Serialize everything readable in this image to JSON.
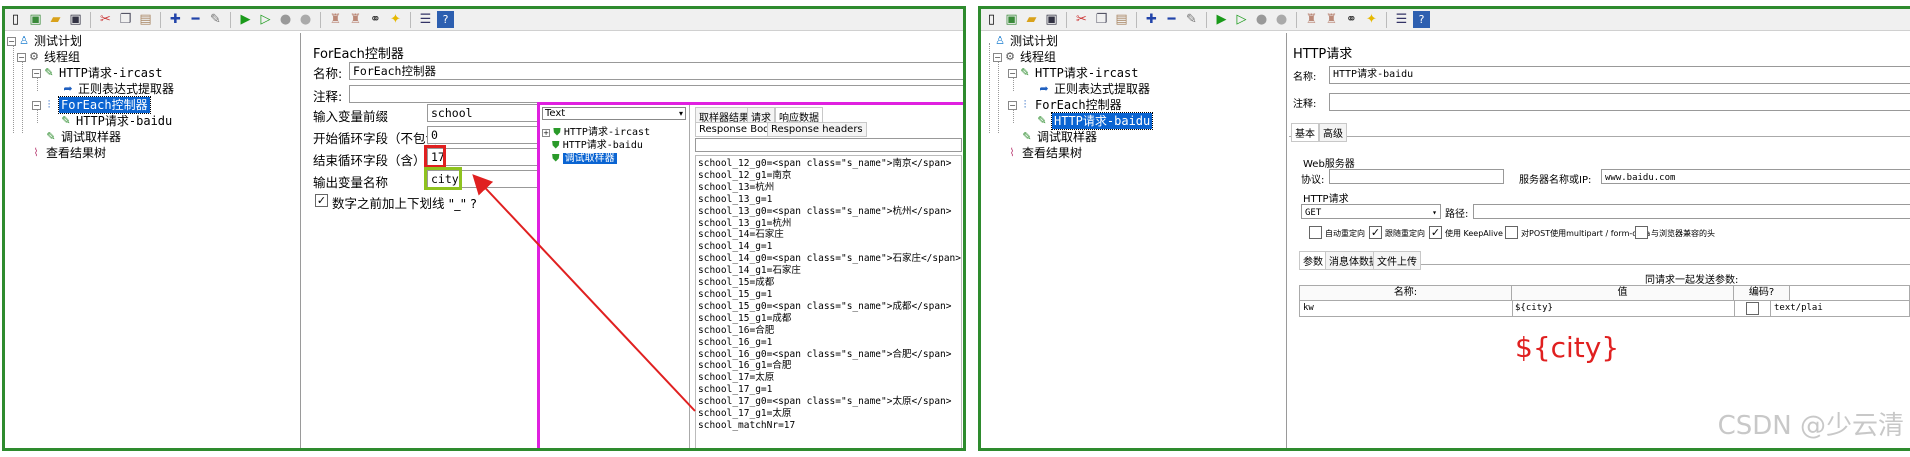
{
  "left": {
    "tree": {
      "root": "测试计划",
      "thread_group": "线程组",
      "http_ircast": "HTTP请求-ircast",
      "regex_extractor": "正则表达式提取器",
      "foreach": "ForEach控制器",
      "http_baidu": "HTTP请求-baidu",
      "debug_sampler": "调试取样器",
      "view_results": "查看结果树"
    },
    "form": {
      "title": "ForEach控制器",
      "name_label": "名称:",
      "name_value": "ForEach控制器",
      "comment_label": "注释:",
      "input_prefix_label": "输入变量前缀",
      "input_prefix_value": "school",
      "start_label": "开始循环字段（不包含）",
      "start_value": "0",
      "end_label": "结束循环字段（含）",
      "end_value": "17",
      "output_label": "输出变量名称",
      "output_value": "city",
      "underscore_label": "数字之前加上下划线 \"_\" ?"
    },
    "popup": {
      "combo": "Text",
      "tree_items": [
        "HTTP请求-ircast",
        "HTTP请求-baidu",
        "调试取样器"
      ],
      "tabs": [
        "取样器结果",
        "请求",
        "响应数据"
      ],
      "subtabs": [
        "Response Body",
        "Response headers"
      ],
      "lines": [
        "school_12_g0=<span class=\"s_name\">南京</span>",
        "school_12_g1=南京",
        "school_13=杭州",
        "school_13_g=1",
        "school_13_g0=<span class=\"s_name\">杭州</span>",
        "school_13_g1=杭州",
        "school_14=石家庄",
        "school_14_g=1",
        "school_14_g0=<span class=\"s_name\">石家庄</span>",
        "school_14_g1=石家庄",
        "school_15=成都",
        "school_15_g=1",
        "school_15_g0=<span class=\"s_name\">成都</span>",
        "school_15_g1=成都",
        "school_16=合肥",
        "school_16_g=1",
        "school_16_g0=<span class=\"s_name\">合肥</span>",
        "school_16_g1=合肥",
        "school_17=太原",
        "school_17_g=1",
        "school_17_g0=<span class=\"s_name\">太原</span>",
        "school_17_g1=太原",
        "school_matchNr=17"
      ]
    }
  },
  "right": {
    "tree": {
      "root": "测试计划",
      "thread_group": "线程组",
      "http_ircast": "HTTP请求-ircast",
      "regex_extractor": "正则表达式提取器",
      "foreach": "ForEach控制器",
      "http_baidu": "HTTP请求-baidu",
      "debug_sampler": "调试取样器",
      "view_results": "查看结果树"
    },
    "form": {
      "title": "HTTP请求",
      "name_label": "名称:",
      "name_value": "HTTP请求-baidu",
      "comment_label": "注释:",
      "tabs": [
        "基本",
        "高级"
      ],
      "web_server": "Web服务器",
      "protocol_label": "协议:",
      "server_label": "服务器名称或IP:",
      "server_value": "www.baidu.com",
      "http_request": "HTTP请求",
      "method": "GET",
      "path_label": "路径:",
      "options": [
        "自动重定向",
        "跟随重定向",
        "使用 KeepAlive",
        "对POST使用multipart / form-data",
        "与浏览器兼容的头"
      ],
      "param_tabs": [
        "参数",
        "消息体数据",
        "文件上传"
      ],
      "send_params": "同请求一起发送参数:",
      "col_name": "名称:",
      "col_value": "值",
      "col_encode": "编码?",
      "row_name": "kw",
      "row_value": "${city}",
      "row_type": "text/plai",
      "annotation": "${city}"
    }
  },
  "watermark": "CSDN @少云清",
  "colors": {
    "panel_border": "#2e8b2e",
    "popup_border": "#e020e0",
    "end_box": "#e02020",
    "output_box": "#8fc31f",
    "arrow": "#e02020",
    "selection": "#0a64d2",
    "annotation": "#e02020"
  }
}
